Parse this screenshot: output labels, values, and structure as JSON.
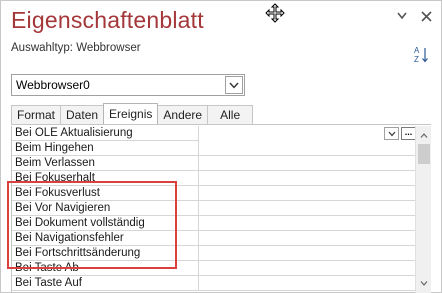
{
  "panel": {
    "title": "Eigenschaftenblatt",
    "selection_type_label": "Auswahltyp:",
    "selection_type_value": "Webbrowser"
  },
  "icons": {
    "move": "move-cursor-icon",
    "dropdown": "chevron-down-icon",
    "close": "close-icon",
    "sort": "sort-az-icon"
  },
  "object_selector": {
    "value": "Webbrowser0"
  },
  "tabs": [
    {
      "label": "Format",
      "active": false
    },
    {
      "label": "Daten",
      "active": false
    },
    {
      "label": "Ereignis",
      "active": true
    },
    {
      "label": "Andere",
      "active": false
    },
    {
      "label": "Alle",
      "active": false
    }
  ],
  "properties": [
    {
      "label": "Bei OLE Aktualisierung",
      "value": ""
    },
    {
      "label": "Beim Hingehen",
      "value": ""
    },
    {
      "label": "Beim Verlassen",
      "value": ""
    },
    {
      "label": "Bei Fokuserhalt",
      "value": ""
    },
    {
      "label": "Bei Fokusverlust",
      "value": ""
    },
    {
      "label": "Bei Vor Navigieren",
      "value": ""
    },
    {
      "label": "Bei Dokument vollständig",
      "value": ""
    },
    {
      "label": "Bei Navigationsfehler",
      "value": ""
    },
    {
      "label": "Bei Fortschrittsänderung",
      "value": ""
    },
    {
      "label": "Bei Taste Ab",
      "value": ""
    },
    {
      "label": "Bei Taste Auf",
      "value": ""
    }
  ],
  "builder_button": {
    "label": "..."
  },
  "colors": {
    "title": "#a4373a",
    "highlight_border": "#d9413f"
  }
}
